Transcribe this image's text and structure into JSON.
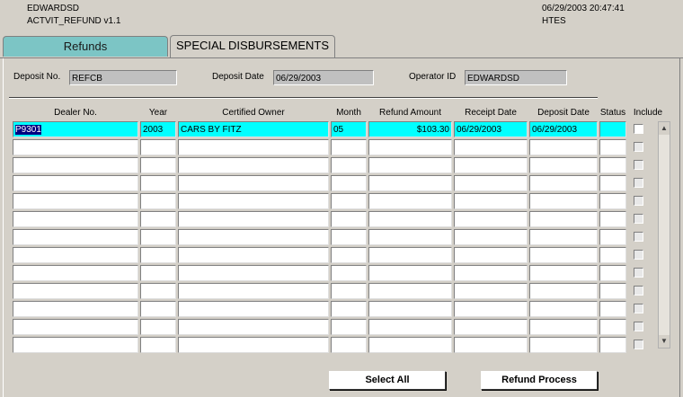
{
  "header": {
    "user": "EDWARDSD",
    "form_name": "ACTVIT_REFUND v1.1",
    "datetime": "06/29/2003 20:47:41",
    "org": "HTES"
  },
  "tabs": [
    {
      "label": "Refunds",
      "active": false
    },
    {
      "label": "SPECIAL DISBURSEMENTS",
      "active": true
    }
  ],
  "fields": {
    "deposit_no_label": "Deposit No.",
    "deposit_no_value": "REFCB",
    "deposit_date_label": "Deposit Date",
    "deposit_date_value": "06/29/2003",
    "operator_id_label": "Operator ID",
    "operator_id_value": "EDWARDSD"
  },
  "columns": [
    "Dealer No.",
    "Year",
    "Certified Owner",
    "Month",
    "Refund Amount",
    "Receipt Date",
    "Deposit Date",
    "Status",
    "Include"
  ],
  "rows": [
    {
      "dealer_no": "P9301",
      "year": "2003",
      "owner": "CARS BY FITZ",
      "month": "05",
      "amount": "$103.30",
      "receipt_date": "06/29/2003",
      "deposit_date": "06/29/2003",
      "status": "",
      "include": false
    },
    {
      "dealer_no": "",
      "year": "",
      "owner": "",
      "month": "",
      "amount": "",
      "receipt_date": "",
      "deposit_date": "",
      "status": "",
      "include": false
    },
    {
      "dealer_no": "",
      "year": "",
      "owner": "",
      "month": "",
      "amount": "",
      "receipt_date": "",
      "deposit_date": "",
      "status": "",
      "include": false
    },
    {
      "dealer_no": "",
      "year": "",
      "owner": "",
      "month": "",
      "amount": "",
      "receipt_date": "",
      "deposit_date": "",
      "status": "",
      "include": false
    },
    {
      "dealer_no": "",
      "year": "",
      "owner": "",
      "month": "",
      "amount": "",
      "receipt_date": "",
      "deposit_date": "",
      "status": "",
      "include": false
    },
    {
      "dealer_no": "",
      "year": "",
      "owner": "",
      "month": "",
      "amount": "",
      "receipt_date": "",
      "deposit_date": "",
      "status": "",
      "include": false
    },
    {
      "dealer_no": "",
      "year": "",
      "owner": "",
      "month": "",
      "amount": "",
      "receipt_date": "",
      "deposit_date": "",
      "status": "",
      "include": false
    },
    {
      "dealer_no": "",
      "year": "",
      "owner": "",
      "month": "",
      "amount": "",
      "receipt_date": "",
      "deposit_date": "",
      "status": "",
      "include": false
    },
    {
      "dealer_no": "",
      "year": "",
      "owner": "",
      "month": "",
      "amount": "",
      "receipt_date": "",
      "deposit_date": "",
      "status": "",
      "include": false
    },
    {
      "dealer_no": "",
      "year": "",
      "owner": "",
      "month": "",
      "amount": "",
      "receipt_date": "",
      "deposit_date": "",
      "status": "",
      "include": false
    },
    {
      "dealer_no": "",
      "year": "",
      "owner": "",
      "month": "",
      "amount": "",
      "receipt_date": "",
      "deposit_date": "",
      "status": "",
      "include": false
    },
    {
      "dealer_no": "",
      "year": "",
      "owner": "",
      "month": "",
      "amount": "",
      "receipt_date": "",
      "deposit_date": "",
      "status": "",
      "include": false
    },
    {
      "dealer_no": "",
      "year": "",
      "owner": "",
      "month": "",
      "amount": "",
      "receipt_date": "",
      "deposit_date": "",
      "status": "",
      "include": false
    }
  ],
  "buttons": {
    "select_all": "Select All",
    "refund_process": "Refund Process"
  },
  "colors": {
    "tab_inactive": "#7cc5c5",
    "selected_row": "#00ffff",
    "window_bg": "#d4d0c8"
  }
}
